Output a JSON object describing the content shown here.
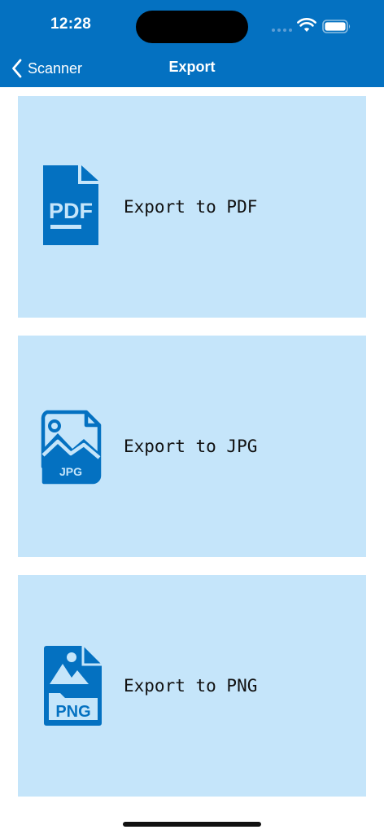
{
  "status_bar": {
    "time": "12:28"
  },
  "nav": {
    "back_label": "Scanner",
    "title": "Export"
  },
  "options": [
    {
      "label": "Export to PDF",
      "badge": "PDF"
    },
    {
      "label": "Export to JPG",
      "badge": "JPG"
    },
    {
      "label": "Export to PNG",
      "badge": "PNG"
    }
  ],
  "colors": {
    "accent": "#0471c1",
    "card_background": "#c5e5fa",
    "background": "#ffffff"
  },
  "icons": {
    "back": "chevron-left-icon",
    "pdf": "pdf-file-icon",
    "jpg": "jpg-file-icon",
    "png": "png-file-icon"
  }
}
